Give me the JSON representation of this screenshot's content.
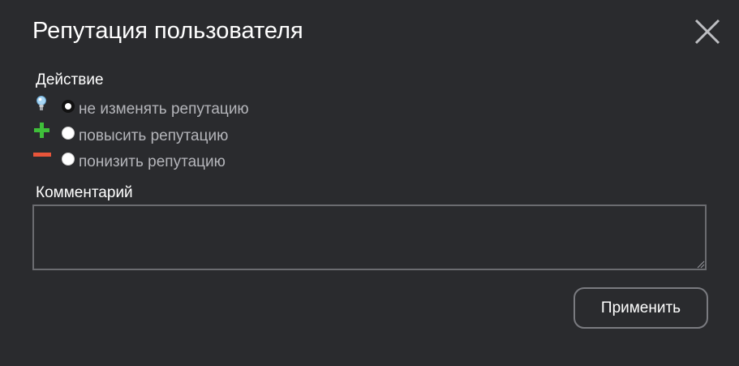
{
  "dialog": {
    "title": "Репутация пользователя",
    "close_icon": "close-icon"
  },
  "action": {
    "label": "Действие",
    "options": [
      {
        "label": "не изменять репутацию",
        "icon": "lightbulb-icon",
        "checked": true
      },
      {
        "label": "повысить репутацию",
        "icon": "plus-icon",
        "checked": false
      },
      {
        "label": "понизить репутацию",
        "icon": "minus-icon",
        "checked": false
      }
    ]
  },
  "comment": {
    "label": "Комментарий",
    "value": ""
  },
  "apply_button": {
    "label": "Применить"
  },
  "colors": {
    "background": "#2a2b2e",
    "text": "#ffffff",
    "option_text": "#b4b5ba",
    "plus": "#3fbf3a",
    "minus": "#e8553a",
    "bulb": "#9fd0f0"
  }
}
